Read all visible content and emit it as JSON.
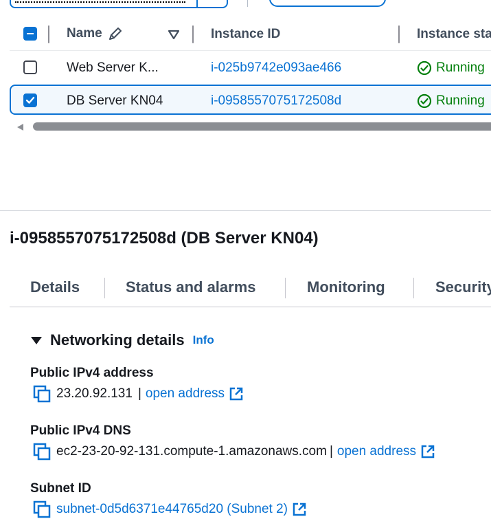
{
  "table": {
    "columns": {
      "name": "Name",
      "instance_id": "Instance ID",
      "instance_state": "Instance sta"
    },
    "rows": [
      {
        "name": "Web Server K...",
        "instance_id": "i-025b9742e093ae466",
        "state": "Running",
        "selected": false
      },
      {
        "name": "DB Server KN04",
        "instance_id": "i-0958557075172508d",
        "state": "Running",
        "selected": true
      }
    ]
  },
  "details": {
    "title": "i-0958557075172508d (DB Server KN04)",
    "tabs": [
      "Details",
      "Status and alarms",
      "Monitoring",
      "Security"
    ],
    "section": {
      "label": "Networking details",
      "info": "Info"
    },
    "fields": {
      "ipv4_label": "Public IPv4 address",
      "ipv4_value": "23.20.92.131",
      "ipv4_link": "open address",
      "dns_label": "Public IPv4 DNS",
      "dns_value": "ec2-23-20-92-131.compute-1.amazonaws.com",
      "dns_link": "open address",
      "subnet_label": "Subnet ID",
      "subnet_value": "subnet-0d5d6371e44765d20 (Subnet 2)"
    }
  },
  "colors": {
    "accent": "#0972d3",
    "success": "#037f0c",
    "text": "#16191f"
  }
}
